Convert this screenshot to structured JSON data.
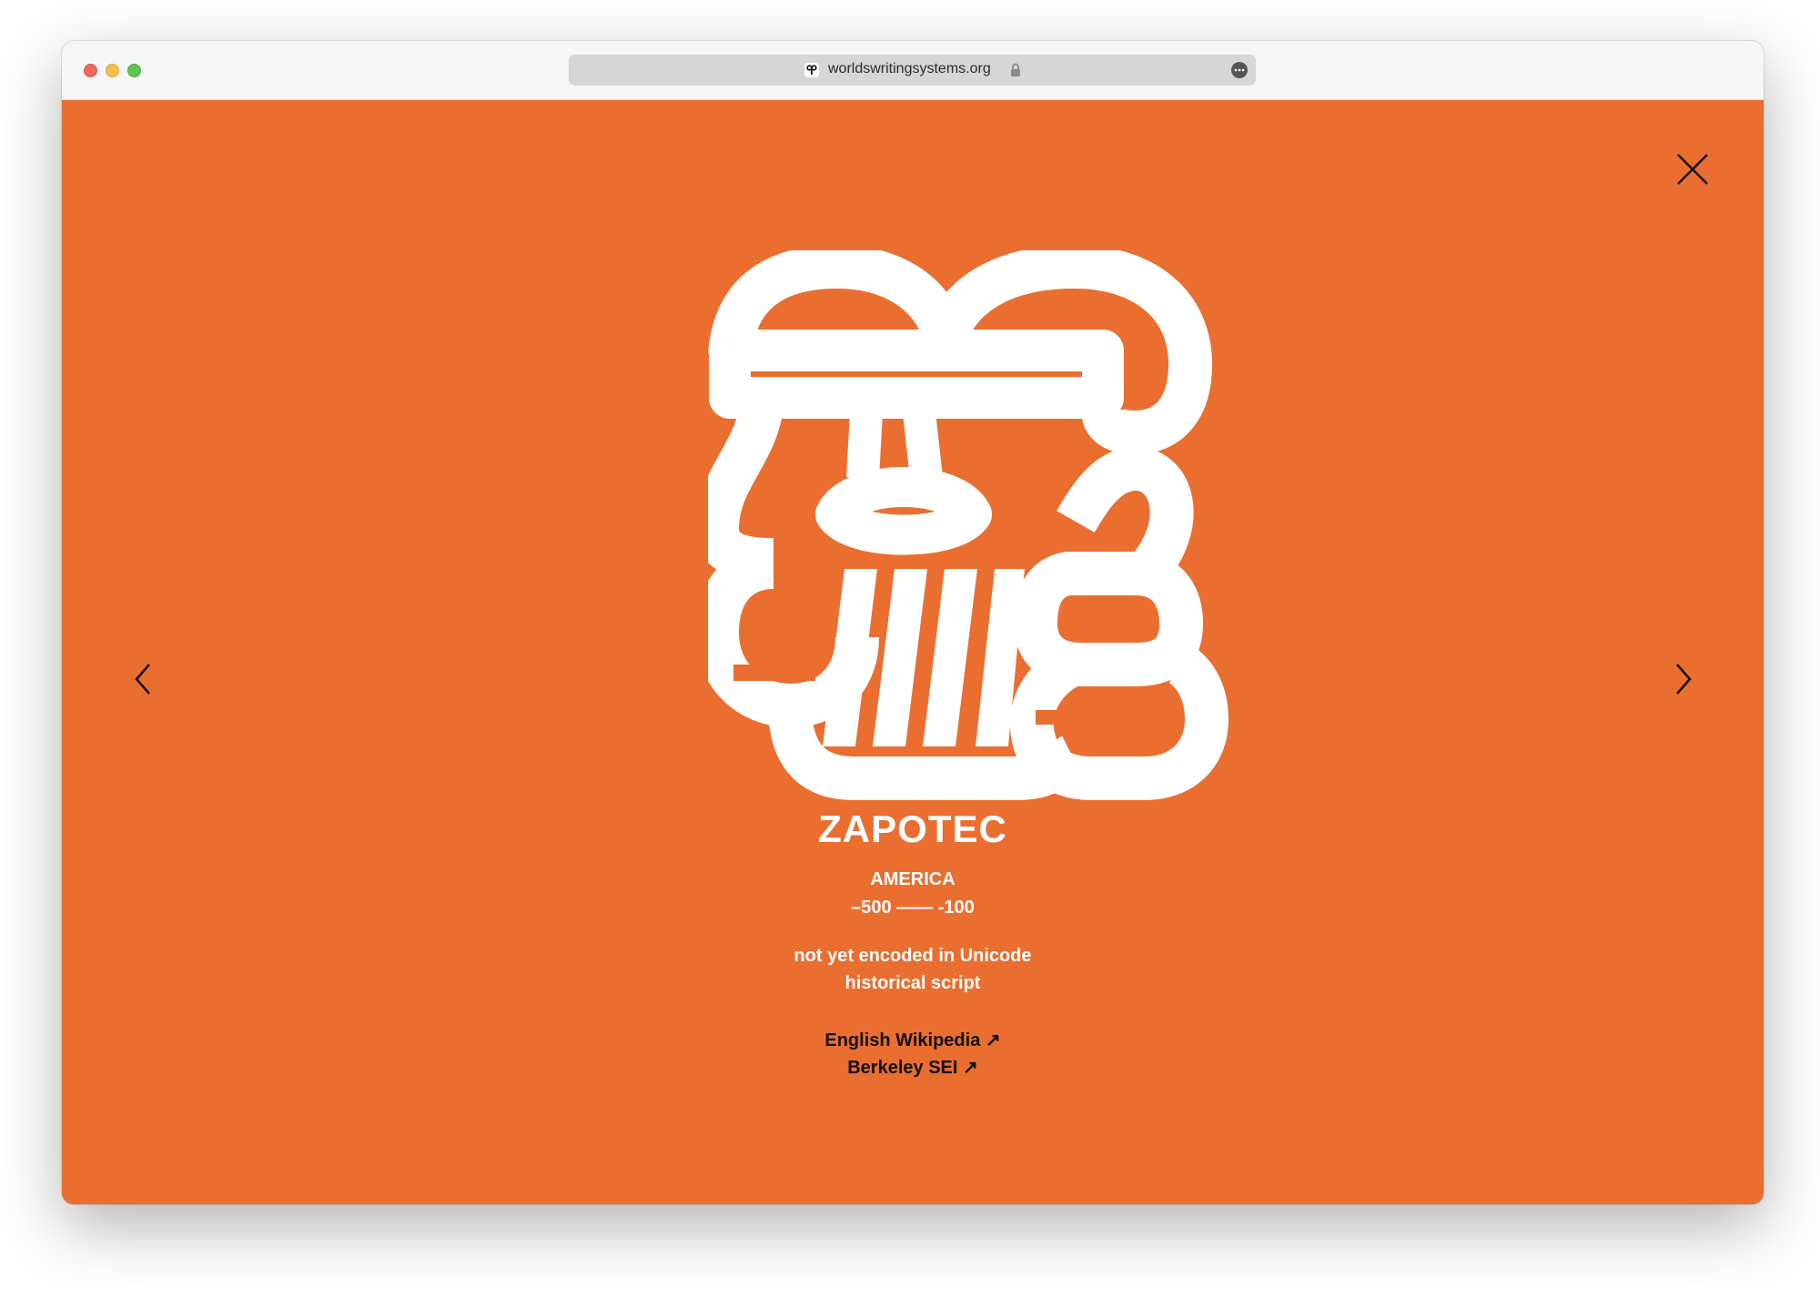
{
  "browser": {
    "url": "worldswritingsystems.org"
  },
  "script": {
    "name": "ZAPOTEC",
    "region": "AMERICA",
    "dates": "–500 —— -100",
    "unicode_status": "not yet encoded in Unicode",
    "script_type": "historical script"
  },
  "links": {
    "wikipedia": "English Wikipedia ↗",
    "berkeley": "Berkeley SEI ↗"
  },
  "colors": {
    "background": "#ea6e2f",
    "glyph": "#ffffff",
    "link_text": "#111111"
  },
  "icons": {
    "close": "close-icon",
    "previous": "chevron-left-icon",
    "next": "chevron-right-icon"
  }
}
